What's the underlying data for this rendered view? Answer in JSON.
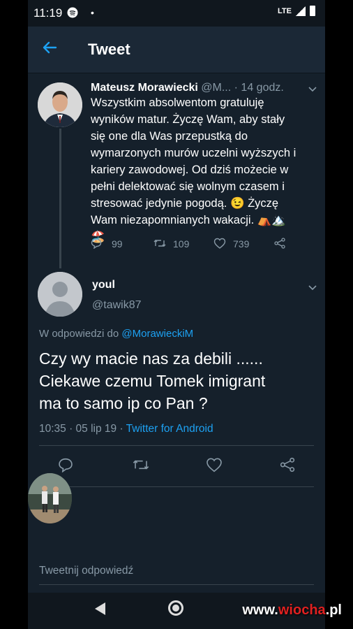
{
  "status_bar": {
    "time": "11:19",
    "network": "LTE"
  },
  "header": {
    "back_icon": "arrow-left-icon",
    "title": "Tweet"
  },
  "tweet": {
    "author_name": "Mateusz Morawiecki",
    "author_handle": "@M...",
    "time_sep": "·",
    "time": "14 godz.",
    "text": "Wszystkim absolwentom gratuluję\nwyników matur. Życzę Wam, aby stały\nsię one dla Was przepustką do\nwymarzonych murów uczelni wyższych i\nkariery zawodowej. Od dziś możecie w\npełni delektować się wolnym czasem i\nstresować jedynie pogodą. 😉 Życzę\nWam niezapomnianych wakacji. ⛺🏔️🏖️",
    "replies": "99",
    "retweets": "109",
    "likes": "739"
  },
  "reply": {
    "author_name": "youl",
    "author_handle": "@tawik87",
    "reply_prefix": "W odpowiedzi do ",
    "reply_mention": "@MorawieckiM",
    "text": "Czy wy macie nas za debili ......\nCiekawe czemu Tomek imigrant\nma to samo ip co Pan ?",
    "time": "10:35 · 05 lip 19 · ",
    "source": "Twitter for Android"
  },
  "compose": {
    "placeholder": "Tweetnij odpowiedź"
  },
  "watermark": {
    "part1": "www.",
    "part2": "wiocha",
    "part3": ".pl"
  },
  "colors": {
    "background": "#15202b",
    "accent": "#1da1f2",
    "secondary_text": "#8899a6"
  }
}
